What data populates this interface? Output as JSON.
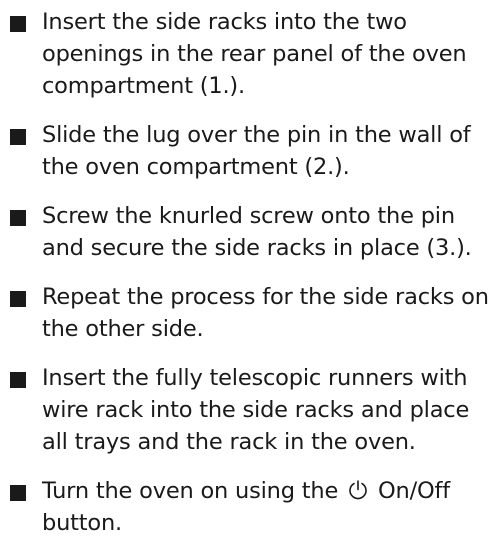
{
  "steps": [
    {
      "text": "Insert the side racks into the two openings in the rear panel of the oven compartment (1.)."
    },
    {
      "text": "Slide the lug over the pin in the wall of the oven compartment (2.)."
    },
    {
      "text": "Screw the knurled screw onto the pin and secure the side racks in place (3.)."
    },
    {
      "text": "Repeat the process for the side racks on the other side."
    },
    {
      "text": "Insert the fully telescopic runners with wire rack into the side racks and place all trays and the rack in the oven."
    },
    {
      "text_before": "Turn the oven on using the",
      "icon": "power-icon",
      "text_after": "On/Off button."
    }
  ]
}
